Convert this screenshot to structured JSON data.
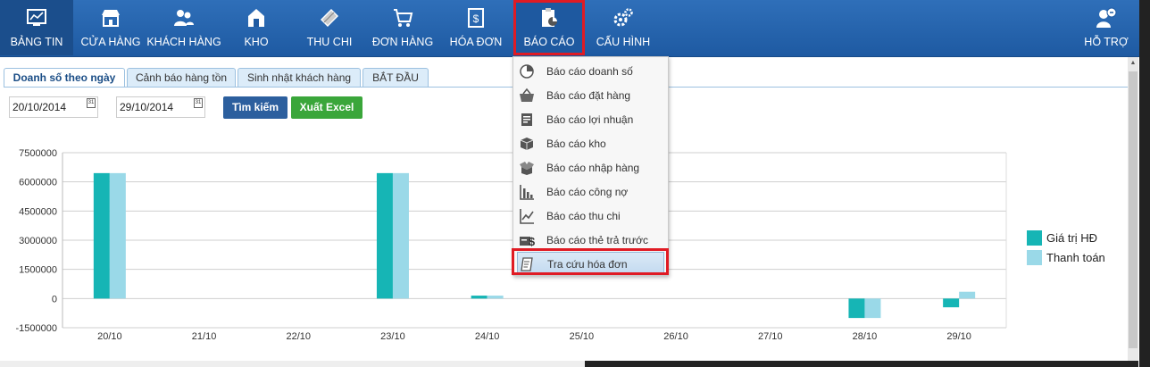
{
  "nav": [
    {
      "label": "BẢNG TIN",
      "icon": "dashboard-icon"
    },
    {
      "label": "CỬA HÀNG",
      "icon": "store-icon"
    },
    {
      "label": "KHÁCH HÀNG",
      "icon": "customers-icon"
    },
    {
      "label": "KHO",
      "icon": "warehouse-icon"
    },
    {
      "label": "THU CHI",
      "icon": "money-icon"
    },
    {
      "label": "ĐƠN HÀNG",
      "icon": "cart-icon"
    },
    {
      "label": "HÓA ĐƠN",
      "icon": "invoice-icon"
    },
    {
      "label": "BÁO CÁO",
      "icon": "report-icon"
    },
    {
      "label": "CẤU HÌNH",
      "icon": "gears-icon"
    },
    {
      "label": "HỖ TRỢ",
      "icon": "support-icon"
    }
  ],
  "tabs": [
    "Doanh số theo ngày",
    "Cảnh báo hàng tồn",
    "Sinh nhật khách hàng",
    "BẮT ĐẦU"
  ],
  "filters": {
    "from_date": "20/10/2014",
    "to_date": "29/10/2014",
    "calendar_icon_text": "31",
    "search_label": "Tìm kiếm",
    "excel_label": "Xuất Excel"
  },
  "menu": {
    "items": [
      {
        "label": "Báo cáo doanh số",
        "icon": "pie-chart-icon"
      },
      {
        "label": "Báo cáo đặt hàng",
        "icon": "basket-icon"
      },
      {
        "label": "Báo cáo lợi nhuận",
        "icon": "profit-doc-icon"
      },
      {
        "label": "Báo cáo kho",
        "icon": "box-icon"
      },
      {
        "label": "Báo cáo nhập hàng",
        "icon": "open-box-icon"
      },
      {
        "label": "Báo cáo công nợ",
        "icon": "bar-chart-icon"
      },
      {
        "label": "Báo cáo thu chi",
        "icon": "line-chart-icon"
      },
      {
        "label": "Báo cáo thẻ trả trước",
        "icon": "prepaid-card-icon"
      },
      {
        "label": "Tra cứu hóa đơn",
        "icon": "invoice-lookup-icon"
      }
    ],
    "highlighted_index": 8
  },
  "colors": {
    "nav_bg": "#1e5aa2",
    "series1": "#16b5b5",
    "series2": "#9ad9e8",
    "highlight": "#e01b24"
  },
  "chart_data": {
    "type": "bar",
    "categories": [
      "20/10",
      "21/10",
      "22/10",
      "23/10",
      "24/10",
      "25/10",
      "26/10",
      "27/10",
      "28/10",
      "29/10"
    ],
    "series": [
      {
        "name": "Giá trị HĐ",
        "values": [
          6450000,
          0,
          0,
          6450000,
          150000,
          0,
          0,
          0,
          -1000000,
          -450000
        ]
      },
      {
        "name": "Thanh toán",
        "values": [
          6450000,
          0,
          0,
          6450000,
          150000,
          0,
          0,
          0,
          -1000000,
          350000
        ]
      }
    ],
    "yticks": [
      7500000,
      6000000,
      4500000,
      3000000,
      1500000,
      0,
      -1500000
    ],
    "ylim": [
      -1500000,
      7500000
    ],
    "legend": "right",
    "grid": true
  }
}
